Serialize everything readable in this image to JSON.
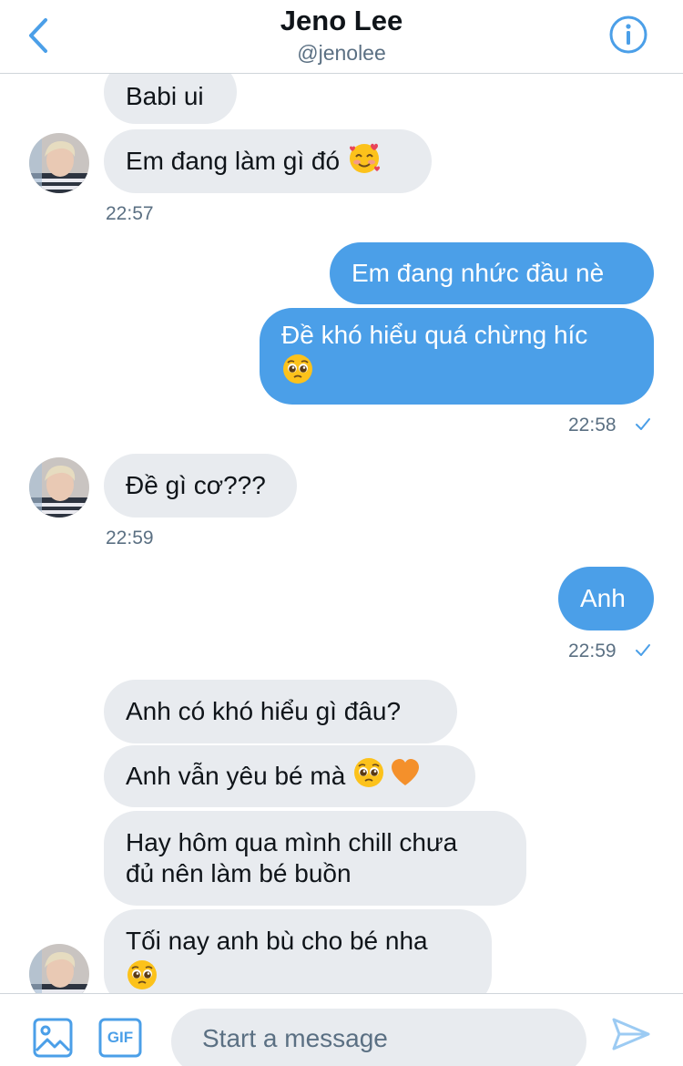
{
  "header": {
    "display_name": "Jeno Lee",
    "handle": "@jenolee"
  },
  "messages": [
    {
      "text": "Babi ui"
    },
    {
      "text": "Em đang làm gì đó "
    },
    {
      "timestamp": "22:57"
    },
    {
      "text": "Em đang nhức đầu nè"
    },
    {
      "text": "Đề khó hiểu quá chừng híc"
    },
    {
      "timestamp": "22:58"
    },
    {
      "text": "Đề gì cơ???"
    },
    {
      "timestamp": "22:59"
    },
    {
      "text": "Anh"
    },
    {
      "timestamp": "22:59"
    },
    {
      "text": "Anh có khó hiểu gì đâu?"
    },
    {
      "text": "Anh vẫn yêu bé mà "
    },
    {
      "text": "Hay hôm qua mình chill chưa\nđủ nên làm bé buồn"
    },
    {
      "text": "Tối nay anh bù cho bé nha"
    }
  ],
  "composer": {
    "placeholder": "Start a message",
    "gif_label": "GIF"
  },
  "colors": {
    "accent": "#4b9fe8",
    "incoming_bubble": "#e8ebef",
    "secondary_text": "#5b7083"
  },
  "icons": [
    "chevron-left-icon",
    "info-icon",
    "image-icon",
    "gif-icon",
    "send-icon",
    "check-icon"
  ]
}
